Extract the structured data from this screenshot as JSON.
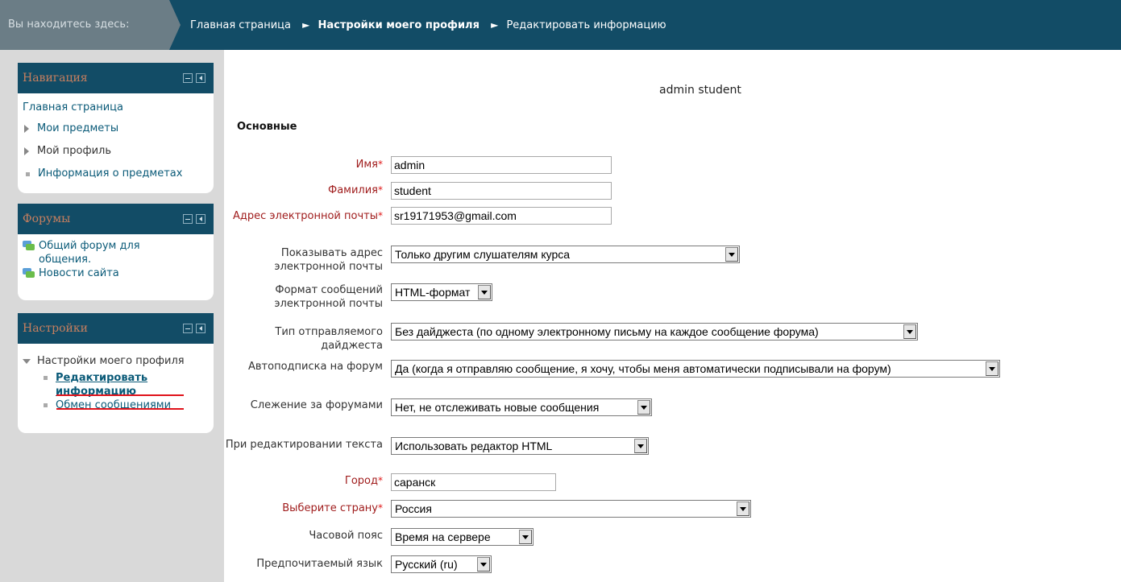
{
  "breadcrumb": {
    "here_label": "Вы находитесь здесь:",
    "items": [
      "Главная страница",
      "Настройки моего профиля",
      "Редактировать информацию"
    ],
    "separator": "►"
  },
  "blocks": {
    "navigation": {
      "title": "Навигация",
      "home": "Главная страница",
      "items": [
        "Мои предметы",
        "Мой профиль",
        "Информация о предметах"
      ]
    },
    "forums": {
      "title": "Форумы",
      "items": [
        "Общий форум для общения.",
        "Новости сайта"
      ]
    },
    "settings": {
      "title": "Настройки",
      "root": "Настройки моего профиля",
      "edit": "Редактировать информацию",
      "messages": "Обмен сообщениями"
    }
  },
  "main": {
    "user": "admin student",
    "section": "Основные",
    "required_mark": "*",
    "fields": {
      "firstname": {
        "label": "Имя",
        "value": "admin"
      },
      "lastname": {
        "label": "Фамилия",
        "value": "student"
      },
      "email": {
        "label": "Адрес электронной почты",
        "value": "sr19171953@gmail.com"
      },
      "show_email": {
        "label": "Показывать адрес электронной почты",
        "value": "Только другим слушателям курса"
      },
      "mail_format": {
        "label": "Формат сообщений электронной почты",
        "value": "HTML-формат"
      },
      "digest": {
        "label": "Тип отправляемого дайджеста",
        "value": "Без дайджеста (по одному электронному письму на каждое сообщение форума)"
      },
      "autosubscribe": {
        "label": "Автоподписка на форум",
        "value": "Да (когда я отправляю сообщение, я хочу, чтобы меня автоматически подписывали на форум)"
      },
      "tracking": {
        "label": "Слежение за форумами",
        "value": "Нет, не отслеживать новые сообщения"
      },
      "editor": {
        "label": "При редактировании текста",
        "value": "Использовать редактор HTML"
      },
      "city": {
        "label": "Город",
        "value": "саранск"
      },
      "country": {
        "label": "Выберите страну",
        "value": "Россия"
      },
      "timezone": {
        "label": "Часовой пояс",
        "value": "Время на сервере"
      },
      "lang": {
        "label": "Предпочитаемый язык",
        "value": "Русский (ru)"
      }
    }
  }
}
